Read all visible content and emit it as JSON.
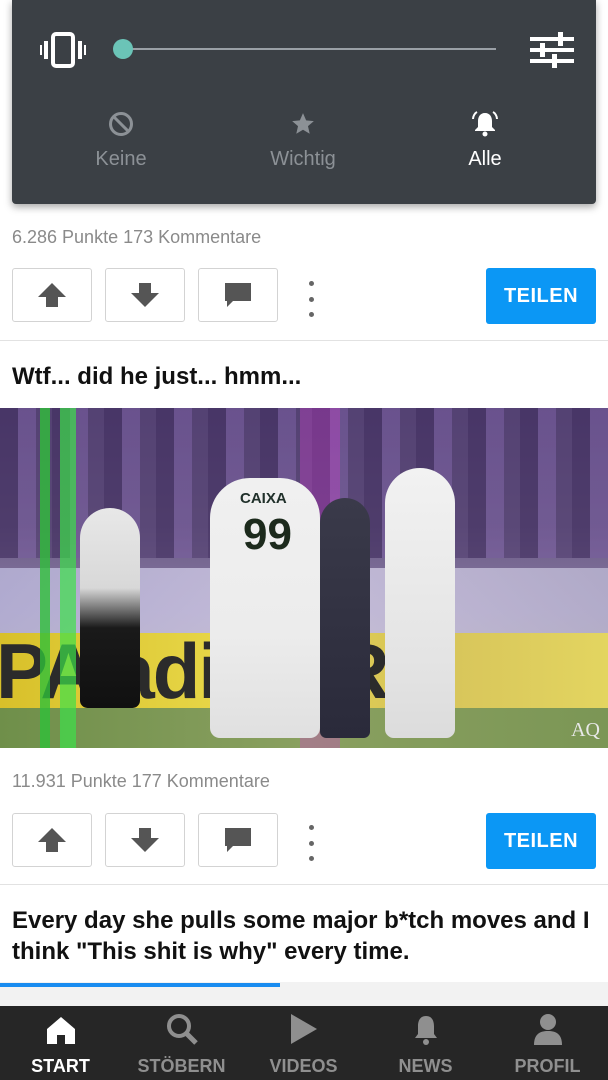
{
  "volume_panel": {
    "vibrate_icon": "vibrate-icon",
    "settings_icon": "tune-icon",
    "slider_level": 0,
    "modes": [
      {
        "label": "Keine",
        "icon": "do-not-disturb-icon",
        "active": false
      },
      {
        "label": "Wichtig",
        "icon": "star-icon",
        "active": false
      },
      {
        "label": "Alle",
        "icon": "bell-icon",
        "active": true
      }
    ]
  },
  "posts": [
    {
      "stats": "6.286 Punkte 173 Kommentare",
      "share_label": "TEILEN"
    },
    {
      "title": "Wtf... did he just... hmm...",
      "image_text": {
        "ad_line": "PA adia BRA",
        "jersey_number": "99",
        "jersey_sponsor": "CAIXA",
        "watermark": "AQ"
      },
      "stats": "11.931 Punkte 177 Kommentare",
      "share_label": "TEILEN"
    },
    {
      "title": "Every day she pulls some major b*tch moves and I think \"This shit is why\" every time."
    }
  ],
  "bottom_nav": [
    {
      "label": "START",
      "icon": "home-icon",
      "active": true
    },
    {
      "label": "STÖBERN",
      "icon": "search-icon",
      "active": false
    },
    {
      "label": "VIDEOS",
      "icon": "play-icon",
      "active": false
    },
    {
      "label": "NEWS",
      "icon": "bell-icon",
      "active": false
    },
    {
      "label": "PROFIL",
      "icon": "profile-icon",
      "active": false
    }
  ],
  "colors": {
    "accent": "#0b97f5",
    "panel": "#3b4045",
    "slider_thumb": "#6bc4b7",
    "nav_bg": "#262626"
  }
}
